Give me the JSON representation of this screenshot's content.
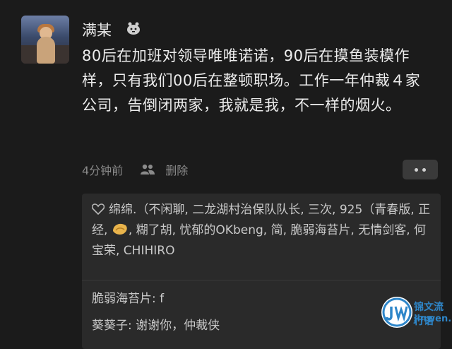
{
  "post": {
    "author": "满某",
    "text": "80后在加班对领导唯唯诺诺，90后在摸鱼装模作样，只有我们00后在整顿职场。工作一年仲裁４家公司，告倒闭两家，我就是我，不一样的烟火。",
    "time": "4分钟前",
    "delete_label": "删除"
  },
  "likes": {
    "text_part1": "绵绵.（不闲聊, 二龙湖村治保队队长, 三次, 925（青春版, 正经, ",
    "text_part2": ", 糊了胡, 忧郁的OKbeng, 简, 脆弱海苔片, 无情剑客, 何宝荣, CHIHIRO"
  },
  "comments": [
    {
      "author": "脆弱海苔片",
      "separator": ":",
      "text": " f"
    },
    {
      "author": "葵葵子",
      "separator": ":",
      "text": " 谢谢你，仲裁侠"
    }
  ],
  "watermark": {
    "line1": "锦文流行语",
    "line2": "jinwen.net"
  },
  "colors": {
    "background": "#1b1b1b",
    "likes_background": "#2a2a2a",
    "watermark": "#2e86c9"
  }
}
